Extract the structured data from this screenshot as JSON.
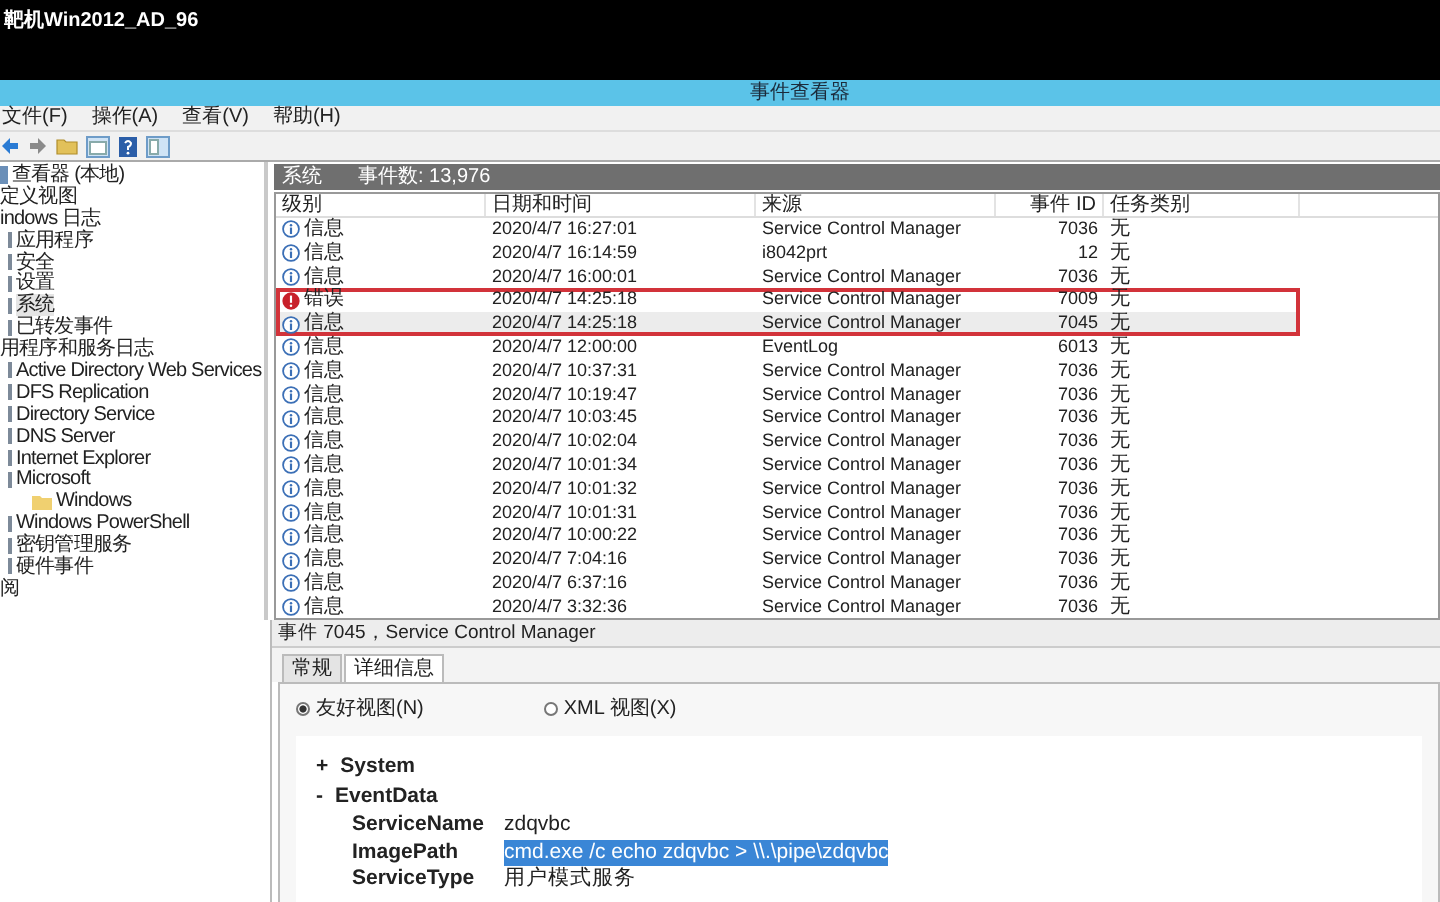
{
  "screen_title": "靶机Win2012_AD_96",
  "window": {
    "title": "事件查看器"
  },
  "menu": [
    "文件(F)",
    "操作(A)",
    "查看(V)",
    "帮助(H)"
  ],
  "tree": [
    {
      "label": "查看器 (本地)",
      "kind": "root",
      "selected": false,
      "children": [
        {
          "label": "定义视图",
          "selected": false
        },
        {
          "label": "indows 日志",
          "selected": false,
          "children": [
            {
              "label": "应用程序",
              "kind": "log",
              "selected": false
            },
            {
              "label": "安全",
              "kind": "log",
              "selected": false
            },
            {
              "label": "设置",
              "kind": "log",
              "selected": false
            },
            {
              "label": "系统",
              "kind": "log",
              "selected": true
            },
            {
              "label": "已转发事件",
              "kind": "log",
              "selected": false
            }
          ]
        },
        {
          "label": "用程序和服务日志",
          "selected": false,
          "children": [
            {
              "label": "Active Directory Web Services",
              "kind": "log",
              "selected": false
            },
            {
              "label": "DFS Replication",
              "kind": "log",
              "selected": false
            },
            {
              "label": "Directory Service",
              "kind": "log",
              "selected": false
            },
            {
              "label": "DNS Server",
              "kind": "log",
              "selected": false
            },
            {
              "label": "Internet Explorer",
              "kind": "log",
              "selected": false
            },
            {
              "label": "Microsoft",
              "kind": "log",
              "selected": false,
              "children": [
                {
                  "label": "Windows",
                  "kind": "folder",
                  "selected": false
                }
              ]
            },
            {
              "label": "Windows PowerShell",
              "kind": "log",
              "selected": false
            },
            {
              "label": "密钥管理服务",
              "kind": "log",
              "selected": false
            },
            {
              "label": "硬件事件",
              "kind": "log",
              "selected": false
            }
          ]
        },
        {
          "label": "阅",
          "selected": false
        }
      ]
    }
  ],
  "log_header": {
    "name": "系统",
    "count": "事件数: 13,976"
  },
  "table": {
    "columns": [
      "级别",
      "日期和时间",
      "来源",
      "事件 ID",
      "任务类别"
    ],
    "rows": [
      {
        "kind": "info",
        "level": "信息",
        "time": "2020/4/7 16:27:01",
        "source": "Service Control Manager",
        "id": "7036",
        "task": "无",
        "selected": false,
        "outlined": false
      },
      {
        "kind": "info",
        "level": "信息",
        "time": "2020/4/7 16:14:59",
        "source": "i8042prt",
        "id": "12",
        "task": "无",
        "selected": false,
        "outlined": false
      },
      {
        "kind": "info",
        "level": "信息",
        "time": "2020/4/7 16:00:01",
        "source": "Service Control Manager",
        "id": "7036",
        "task": "无",
        "selected": false,
        "outlined": false
      },
      {
        "kind": "error",
        "level": "错误",
        "time": "2020/4/7 14:25:18",
        "source": "Service Control Manager",
        "id": "7009",
        "task": "无",
        "selected": false,
        "outlined": true
      },
      {
        "kind": "info",
        "level": "信息",
        "time": "2020/4/7 14:25:18",
        "source": "Service Control Manager",
        "id": "7045",
        "task": "无",
        "selected": true,
        "outlined": true
      },
      {
        "kind": "info",
        "level": "信息",
        "time": "2020/4/7 12:00:00",
        "source": "EventLog",
        "id": "6013",
        "task": "无",
        "selected": false,
        "outlined": false
      },
      {
        "kind": "info",
        "level": "信息",
        "time": "2020/4/7 10:37:31",
        "source": "Service Control Manager",
        "id": "7036",
        "task": "无",
        "selected": false,
        "outlined": false
      },
      {
        "kind": "info",
        "level": "信息",
        "time": "2020/4/7 10:19:47",
        "source": "Service Control Manager",
        "id": "7036",
        "task": "无",
        "selected": false,
        "outlined": false
      },
      {
        "kind": "info",
        "level": "信息",
        "time": "2020/4/7 10:03:45",
        "source": "Service Control Manager",
        "id": "7036",
        "task": "无",
        "selected": false,
        "outlined": false
      },
      {
        "kind": "info",
        "level": "信息",
        "time": "2020/4/7 10:02:04",
        "source": "Service Control Manager",
        "id": "7036",
        "task": "无",
        "selected": false,
        "outlined": false
      },
      {
        "kind": "info",
        "level": "信息",
        "time": "2020/4/7 10:01:34",
        "source": "Service Control Manager",
        "id": "7036",
        "task": "无",
        "selected": false,
        "outlined": false
      },
      {
        "kind": "info",
        "level": "信息",
        "time": "2020/4/7 10:01:32",
        "source": "Service Control Manager",
        "id": "7036",
        "task": "无",
        "selected": false,
        "outlined": false
      },
      {
        "kind": "info",
        "level": "信息",
        "time": "2020/4/7 10:01:31",
        "source": "Service Control Manager",
        "id": "7036",
        "task": "无",
        "selected": false,
        "outlined": false
      },
      {
        "kind": "info",
        "level": "信息",
        "time": "2020/4/7 10:00:22",
        "source": "Service Control Manager",
        "id": "7036",
        "task": "无",
        "selected": false,
        "outlined": false
      },
      {
        "kind": "info",
        "level": "信息",
        "time": "2020/4/7 7:04:16",
        "source": "Service Control Manager",
        "id": "7036",
        "task": "无",
        "selected": false,
        "outlined": false
      },
      {
        "kind": "info",
        "level": "信息",
        "time": "2020/4/7 6:37:16",
        "source": "Service Control Manager",
        "id": "7036",
        "task": "无",
        "selected": false,
        "outlined": false
      },
      {
        "kind": "info",
        "level": "信息",
        "time": "2020/4/7 3:32:36",
        "source": "Service Control Manager",
        "id": "7036",
        "task": "无",
        "selected": false,
        "outlined": false
      }
    ]
  },
  "detail": {
    "title": "事件 7045，Service Control Manager",
    "tabs": [
      {
        "label": "常规",
        "selected": false
      },
      {
        "label": "详细信息",
        "selected": true
      }
    ],
    "views": [
      {
        "label": "友好视图(N)",
        "selected": true
      },
      {
        "label": "XML 视图(X)",
        "selected": false
      }
    ],
    "sections": [
      {
        "toggle": "+",
        "label": "System"
      },
      {
        "toggle": "-",
        "label": "EventData",
        "fields": [
          {
            "name": "ServiceName",
            "value": "zdqvbc",
            "selected": false
          },
          {
            "name": "ImagePath",
            "value": "cmd.exe /c echo zdqvbc > \\\\.\\pipe\\zdqvbc",
            "selected": true
          },
          {
            "name": "ServiceType",
            "value": "用户模式服务",
            "selected": false
          }
        ]
      }
    ]
  }
}
